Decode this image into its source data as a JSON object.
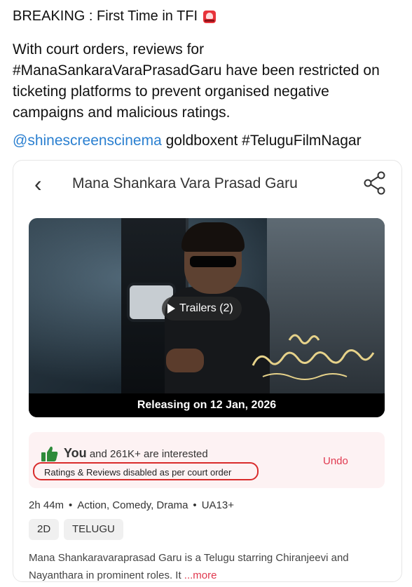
{
  "post": {
    "headline": "BREAKING : First Time in TFI",
    "body": "With court orders, reviews for #ManaSankaraVaraPrasadGaru have been restricted on ticketing platforms to prevent organised negative campaigns and malicious ratings.",
    "mention": "@shinescreenscinema",
    "tags_rest": " goldboxent #TeluguFilmNagar"
  },
  "app": {
    "title": "Mana Shankara Vara Prasad Garu",
    "trailers_label": "Trailers (2)",
    "release": "Releasing on 12 Jan, 2026",
    "you": "You",
    "interested_rest": " and 261K+  are interested",
    "court_notice": "Ratings & Reviews disabled as per court order",
    "undo": "Undo",
    "meta": {
      "duration": "2h 44m",
      "genres": "Action, Comedy, Drama",
      "rating": "UA13+",
      "separator": "•"
    },
    "formats": [
      "2D",
      "TELUGU"
    ],
    "description": "Mana Shankaravaraprasad Garu is a Telugu starring Chiranjeevi and Nayanthara in prominent roles. It",
    "more": "...more"
  },
  "colors": {
    "accent": "#e0394f",
    "link": "#2a7fd0",
    "highlight_box": "#d92b2b",
    "interest_bg": "#fdf2f3",
    "thumb": "#2e8b3a"
  },
  "icons": [
    "siren-icon",
    "back-chevron-icon",
    "share-icon",
    "play-icon",
    "thumbs-up-icon"
  ]
}
